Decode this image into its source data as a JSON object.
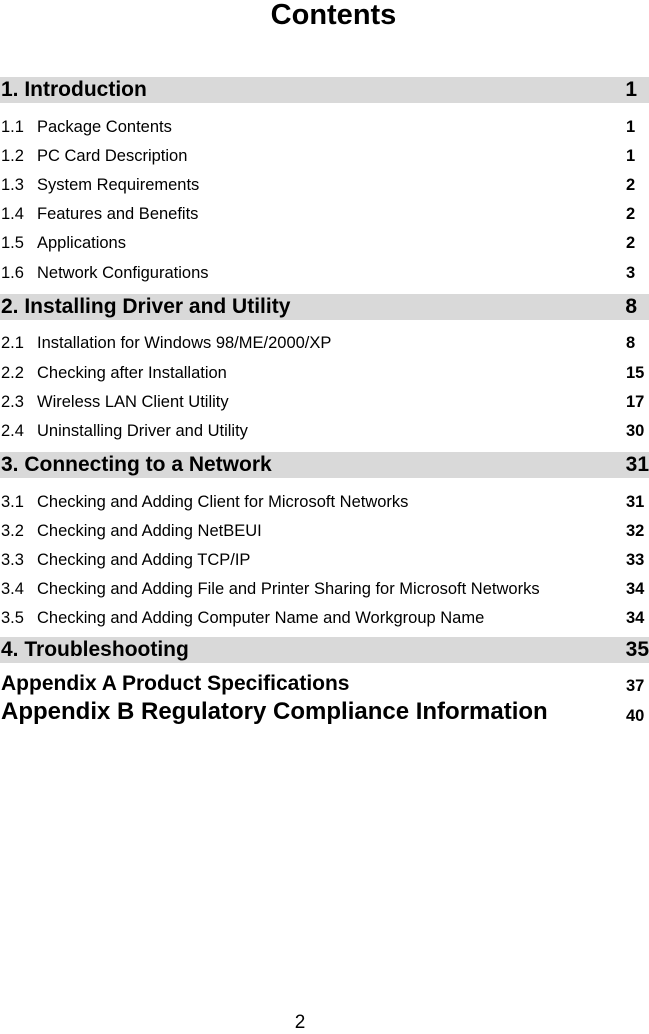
{
  "title": "Contents",
  "chapters": [
    {
      "title": "1. Introduction",
      "page": "1",
      "sections": [
        {
          "num": "1.1",
          "title": "Package Contents",
          "page": "1"
        },
        {
          "num": "1.2",
          "title": "PC Card Description",
          "page": "1"
        },
        {
          "num": "1.3",
          "title": "System Requirements",
          "page": "2"
        },
        {
          "num": "1.4",
          "title": "Features and Benefits",
          "page": "2"
        },
        {
          "num": "1.5",
          "title": "Applications",
          "page": "2"
        },
        {
          "num": "1.6",
          "title": "Network Configurations",
          "page": "3"
        }
      ]
    },
    {
      "title": "2. Installing Driver and Utility",
      "page": "8",
      "sections": [
        {
          "num": "2.1",
          "title": "Installation for Windows 98/ME/2000/XP",
          "page": "8"
        },
        {
          "num": "2.2",
          "title": "Checking after Installation",
          "page": "15"
        },
        {
          "num": "2.3",
          "title": "Wireless LAN Client Utility",
          "page": "17"
        },
        {
          "num": "2.4",
          "title": "Uninstalling Driver and Utility",
          "page": "30"
        }
      ]
    },
    {
      "title": "3. Connecting to a Network",
      "page": "31",
      "sections": [
        {
          "num": "3.1",
          "title": "Checking and Adding Client for Microsoft Networks",
          "page": "31"
        },
        {
          "num": "3.2",
          "title": "Checking and Adding NetBEUI",
          "page": "32"
        },
        {
          "num": "3.3",
          "title": "Checking and Adding TCP/IP",
          "page": "33"
        },
        {
          "num": "3.4",
          "title": "Checking and Adding File and Printer Sharing for Microsoft Networks",
          "page": "34"
        },
        {
          "num": "3.5",
          "title": "Checking and Adding Computer Name and Workgroup Name",
          "page": "34"
        }
      ]
    },
    {
      "title": "4. Troubleshooting",
      "page": "35",
      "sections": []
    }
  ],
  "appendices": [
    {
      "title": "Appendix A Product Specifications",
      "page": "37"
    },
    {
      "title": "Appendix B Regulatory Compliance Information",
      "page": "40"
    }
  ],
  "page_number": "2",
  "colors": {
    "chapter_band": "#d9d9d9",
    "text": "#000000"
  }
}
